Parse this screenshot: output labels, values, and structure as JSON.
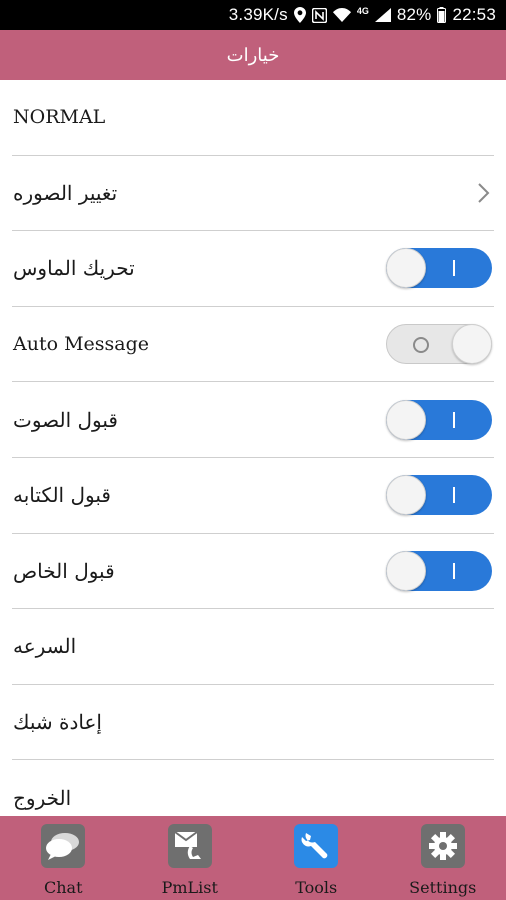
{
  "status_bar": {
    "speed": "3.39K/s",
    "network": "4G",
    "battery": "82%",
    "time": "22:53",
    "icons": [
      "location-icon",
      "nfc-icon",
      "wifi-icon",
      "signal-icon",
      "battery-icon"
    ]
  },
  "header": {
    "title": "خيارات"
  },
  "settings": {
    "items": [
      {
        "label": "NORMAL",
        "control": "none"
      },
      {
        "label": "تغيير الصوره",
        "control": "chevron-right-icon"
      },
      {
        "label": "تحريك الماوس",
        "control": "toggle",
        "state": "on"
      },
      {
        "label": "Auto Message",
        "control": "toggle",
        "state": "off"
      },
      {
        "label": "قبول الصوت",
        "control": "toggle",
        "state": "on"
      },
      {
        "label": "قبول الكتابه",
        "control": "toggle",
        "state": "on"
      },
      {
        "label": "قبول الخاص",
        "control": "toggle",
        "state": "on"
      },
      {
        "label": "السرعه",
        "control": "none"
      },
      {
        "label": "إعادة شبك",
        "control": "none"
      },
      {
        "label": "الخروج",
        "control": "none"
      }
    ]
  },
  "bottom_nav": {
    "items": [
      {
        "label": "Chat",
        "icon": "chat-icon"
      },
      {
        "label": "PmList",
        "icon": "pm-list-icon"
      },
      {
        "label": "Tools",
        "icon": "tools-icon"
      },
      {
        "label": "Settings",
        "icon": "settings-icon"
      }
    ]
  },
  "colors": {
    "accent": "#c0607b",
    "toggle_on": "#2979d9",
    "tools_icon_bg": "#2b8ae6",
    "gray_icon_bg": "#6f6f6f"
  }
}
